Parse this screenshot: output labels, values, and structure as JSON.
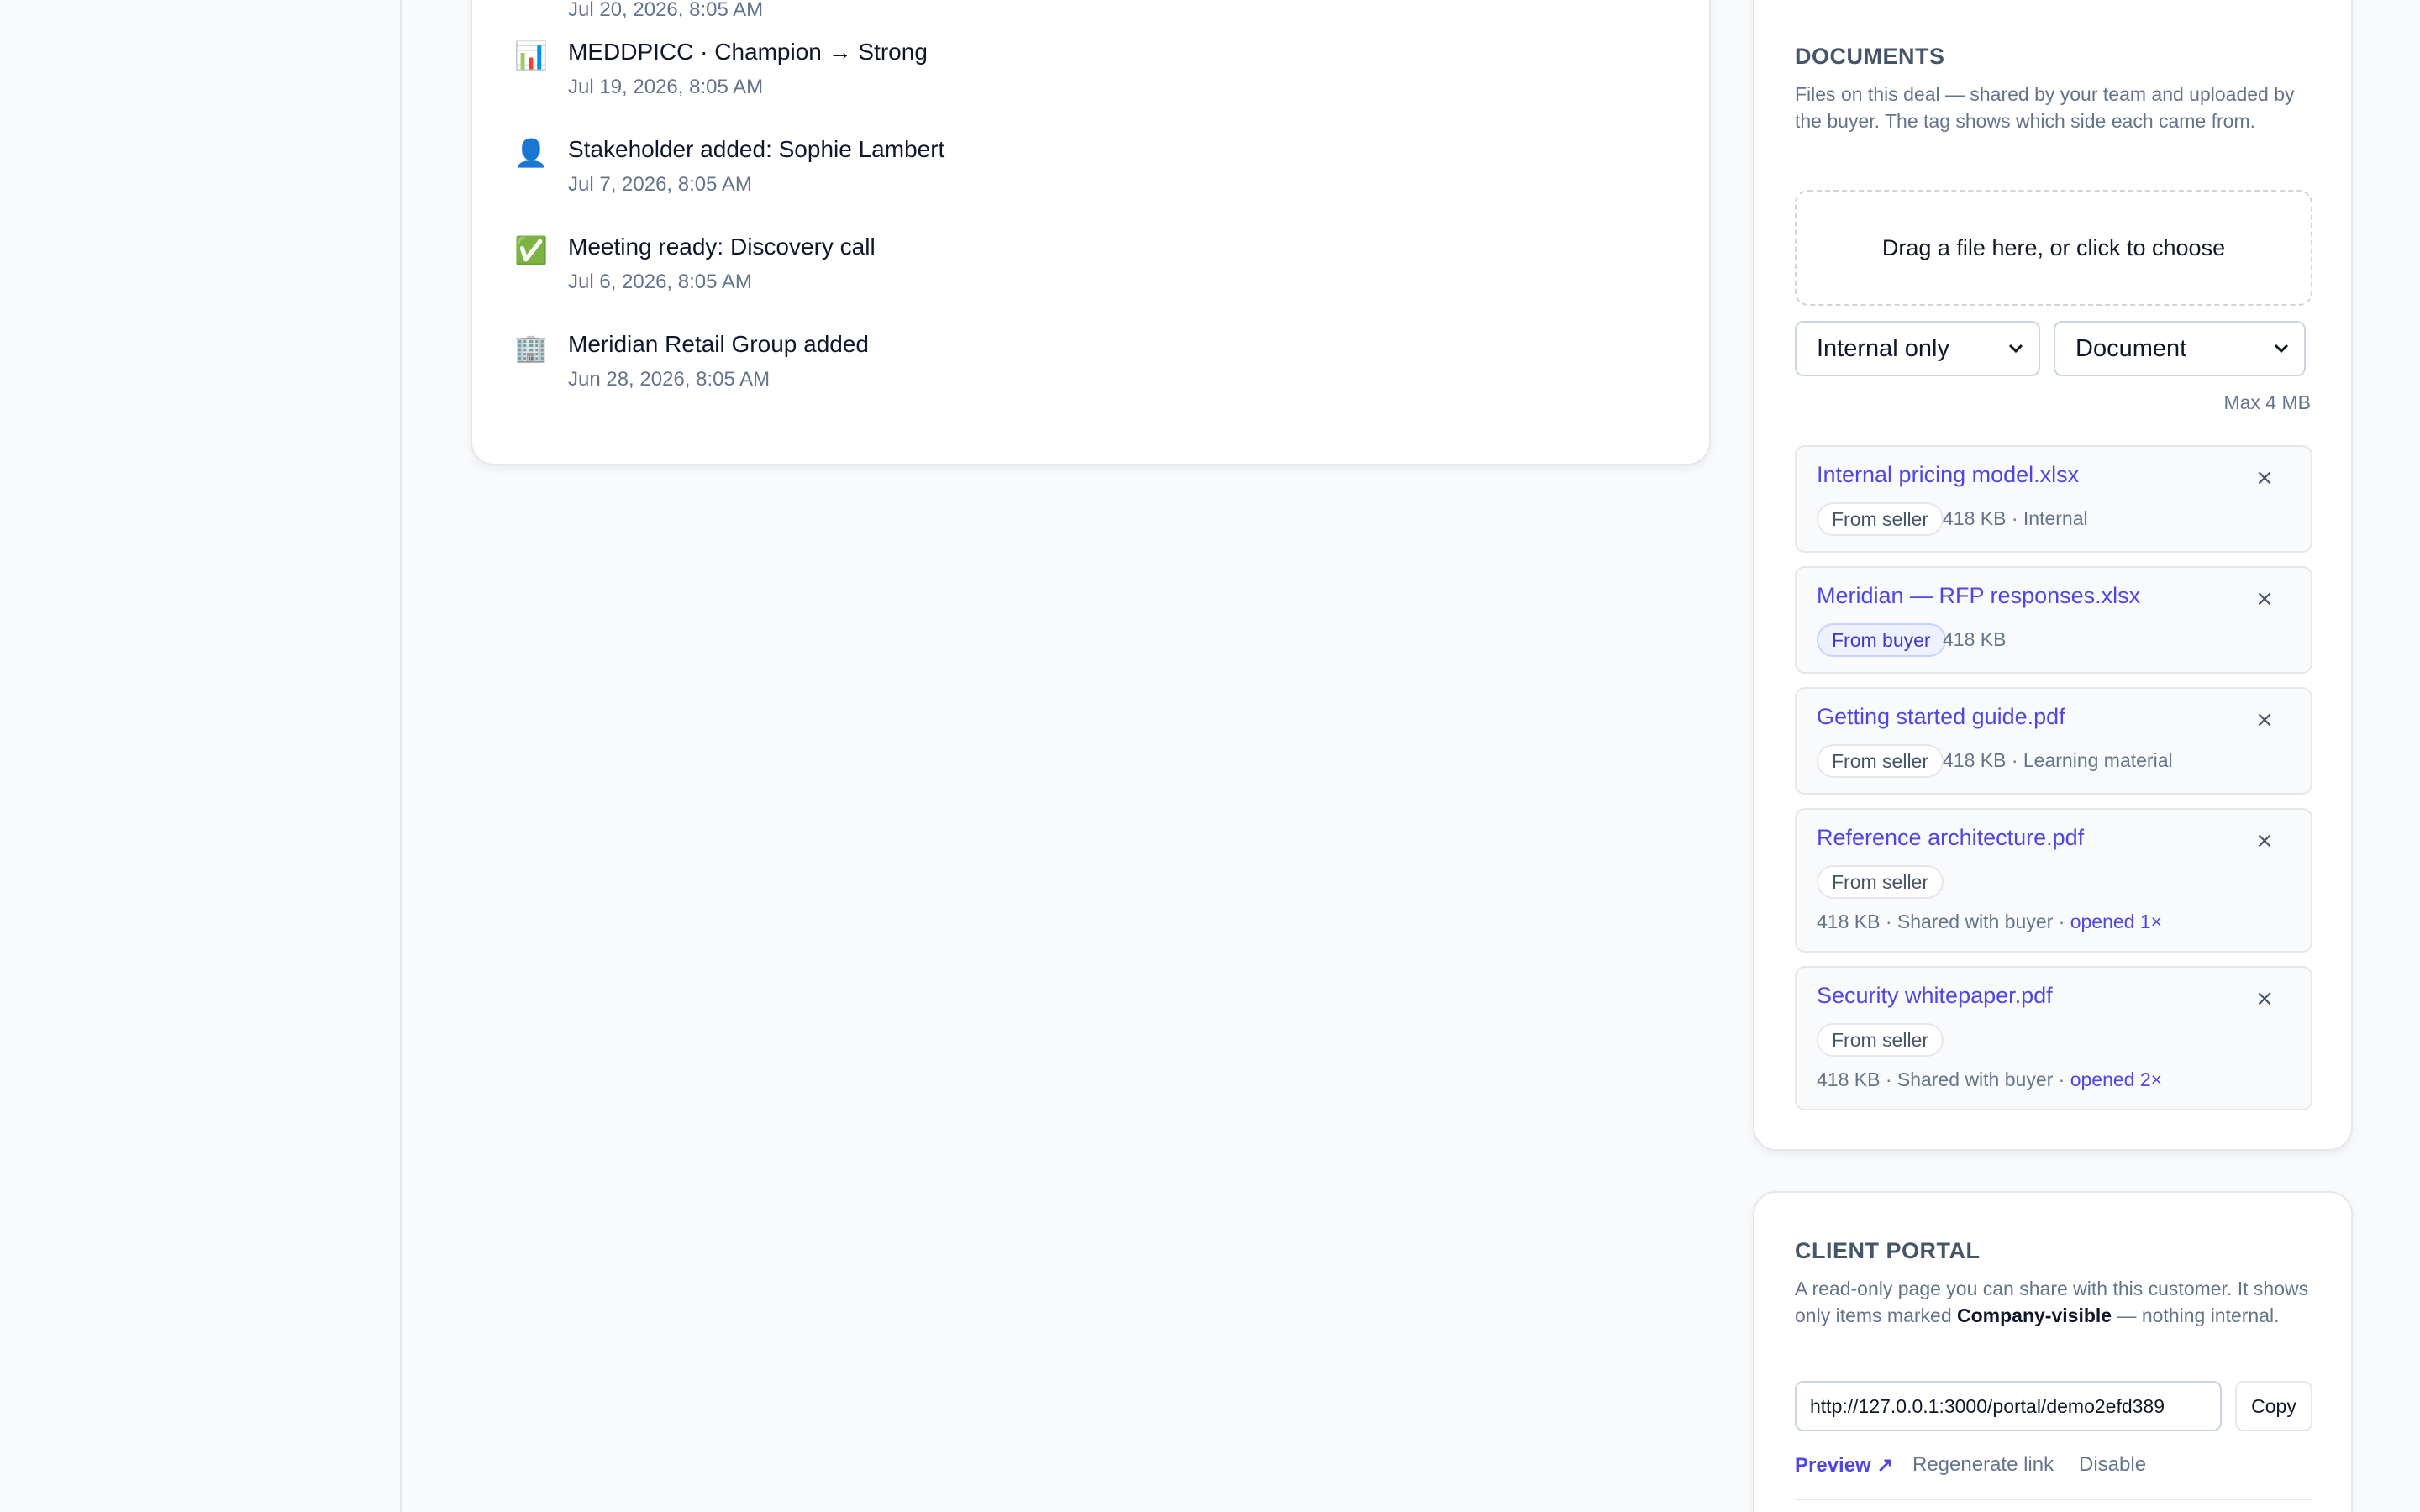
{
  "timeline": {
    "items": [
      {
        "icon": "check-icon",
        "glyph": "✅",
        "title": "",
        "time": "Jul 20, 2026, 8:05 AM"
      },
      {
        "icon": "bar-chart-icon",
        "glyph": "📊",
        "title": "MEDDPICC · Champion → Strong",
        "time": "Jul 19, 2026, 8:05 AM"
      },
      {
        "icon": "user-icon",
        "glyph": "👤",
        "title": "Stakeholder added: Sophie Lambert",
        "time": "Jul 7, 2026, 8:05 AM"
      },
      {
        "icon": "check-icon",
        "glyph": "✅",
        "title": "Meeting ready: Discovery call",
        "time": "Jul 6, 2026, 8:05 AM"
      },
      {
        "icon": "building-icon",
        "glyph": "🏢",
        "title": "Meridian Retail Group added",
        "time": "Jun 28, 2026, 8:05 AM"
      }
    ]
  },
  "documents": {
    "heading": "DOCUMENTS",
    "description": "Files on this deal — shared by your team and uploaded by the buyer. The tag shows which side each came from.",
    "dropzone": "Drag a file here, or click to choose",
    "visibility_select": "Internal only",
    "type_select": "Document",
    "max_size": "Max 4 MB",
    "items": [
      {
        "name": "Internal pricing model.xlsx",
        "tag": "From seller",
        "meta": "418 KB · Internal",
        "opened": ""
      },
      {
        "name": "Meridian — RFP responses.xlsx",
        "tag": "From buyer",
        "meta": "418 KB",
        "opened": ""
      },
      {
        "name": "Getting started guide.pdf",
        "tag": "From seller",
        "meta": "418 KB · Learning material",
        "opened": ""
      },
      {
        "name": "Reference architecture.pdf",
        "tag": "From seller",
        "meta": "418 KB · Shared with buyer · ",
        "opened": "opened 1×"
      },
      {
        "name": "Security whitepaper.pdf",
        "tag": "From seller",
        "meta": "418 KB · Shared with buyer · ",
        "opened": "opened 2×"
      }
    ],
    "close_glyph": "×"
  },
  "portal": {
    "heading": "CLIENT PORTAL",
    "desc_before": "A read-only page you can share with this customer. It shows only items marked ",
    "desc_bold": "Company-visible",
    "desc_after": " — nothing internal.",
    "url": "http://127.0.0.1:3000/portal/demo2efd389",
    "copy": "Copy",
    "preview": "Preview ↗",
    "regenerate": "Regenerate link",
    "disable": "Disable"
  },
  "colors": {
    "accent": "#4f46e5",
    "muted": "#64748b",
    "border": "#e5e7eb"
  }
}
